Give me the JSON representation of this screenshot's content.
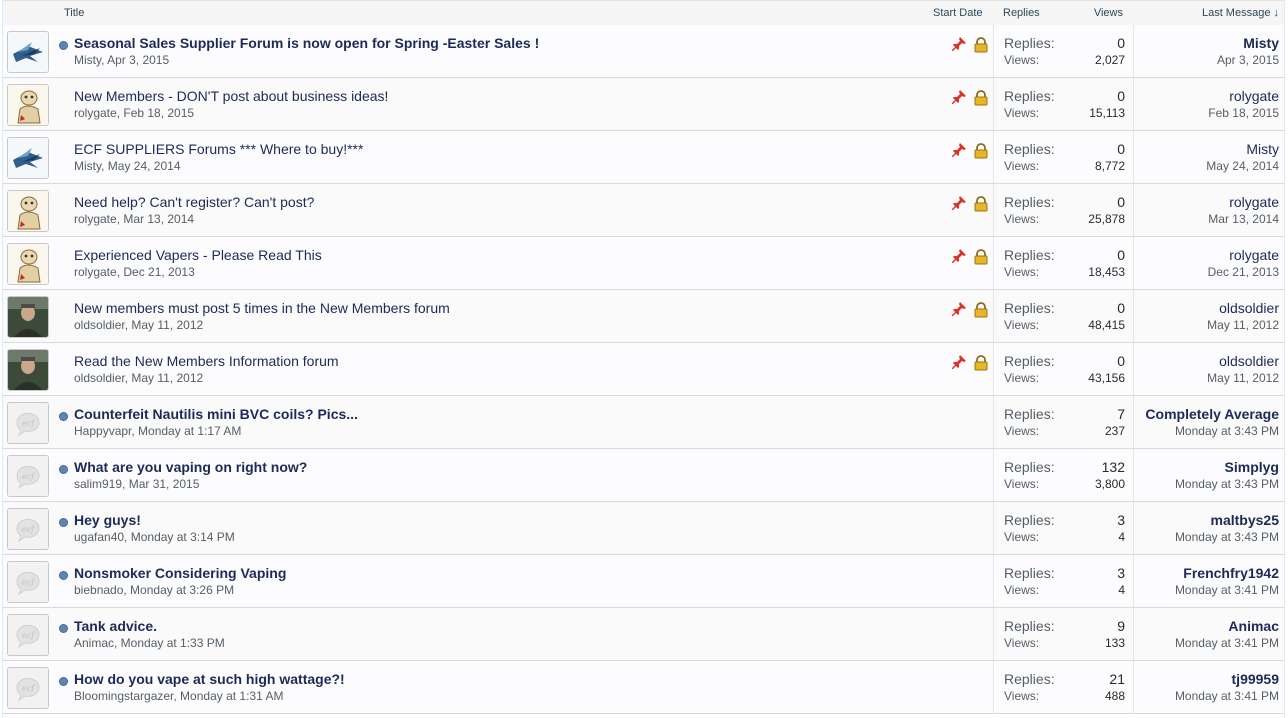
{
  "columns": {
    "title": "Title",
    "start_date": "Start Date",
    "replies": "Replies",
    "views": "Views",
    "last_message": "Last Message ↓"
  },
  "labels": {
    "replies": "Replies:",
    "views": "Views:"
  },
  "threads": [
    {
      "title": "Seasonal Sales Supplier Forum is now open for Spring -Easter Sales !",
      "meta": "Misty, Apr 3, 2015",
      "replies": "0",
      "views": "2,027",
      "last_user": "Misty",
      "last_date": "Apr 3, 2015",
      "avatar": "bird-avatar",
      "sticky": true,
      "unread": true
    },
    {
      "title": "New Members - DON'T post about business ideas!",
      "meta": "rolygate, Feb 18, 2015",
      "replies": "0",
      "views": "15,113",
      "last_user": "rolygate",
      "last_date": "Feb 18, 2015",
      "avatar": "cartoon-avatar",
      "sticky": true,
      "unread": false
    },
    {
      "title": "ECF SUPPLIERS Forums *** Where to buy!***",
      "meta": "Misty, May 24, 2014",
      "replies": "0",
      "views": "8,772",
      "last_user": "Misty",
      "last_date": "May 24, 2014",
      "avatar": "bird-avatar",
      "sticky": true,
      "unread": false
    },
    {
      "title": "Need help? Can't register? Can't post?",
      "meta": "rolygate, Mar 13, 2014",
      "replies": "0",
      "views": "25,878",
      "last_user": "rolygate",
      "last_date": "Mar 13, 2014",
      "avatar": "cartoon-avatar",
      "sticky": true,
      "unread": false
    },
    {
      "title": "Experienced Vapers - Please Read This",
      "meta": "rolygate, Dec 21, 2013",
      "replies": "0",
      "views": "18,453",
      "last_user": "rolygate",
      "last_date": "Dec 21, 2013",
      "avatar": "cartoon-avatar",
      "sticky": true,
      "unread": false
    },
    {
      "title": "New members must post 5 times in the New Members forum",
      "meta": "oldsoldier, May 11, 2012",
      "replies": "0",
      "views": "48,415",
      "last_user": "oldsoldier",
      "last_date": "May 11, 2012",
      "avatar": "photo-avatar",
      "sticky": true,
      "unread": false
    },
    {
      "title": "Read the New Members Information forum",
      "meta": "oldsoldier, May 11, 2012",
      "replies": "0",
      "views": "43,156",
      "last_user": "oldsoldier",
      "last_date": "May 11, 2012",
      "avatar": "photo-avatar",
      "sticky": true,
      "unread": false
    },
    {
      "title": "Counterfeit Nautilis mini BVC coils? Pics...",
      "meta": "Happyvapr, Monday at 1:17 AM",
      "replies": "7",
      "views": "237",
      "last_user": "Completely Average",
      "last_date": "Monday at 3:43 PM",
      "avatar": "default-avatar",
      "sticky": false,
      "unread": true
    },
    {
      "title": "What are you vaping on right now?",
      "meta": "salim919, Mar 31, 2015",
      "replies": "132",
      "views": "3,800",
      "last_user": "Simplyg",
      "last_date": "Monday at 3:43 PM",
      "avatar": "default-avatar",
      "sticky": false,
      "unread": true
    },
    {
      "title": "Hey guys!",
      "meta": "ugafan40, Monday at 3:14 PM",
      "replies": "3",
      "views": "4",
      "last_user": "maltbys25",
      "last_date": "Monday at 3:43 PM",
      "avatar": "default-avatar",
      "sticky": false,
      "unread": true
    },
    {
      "title": "Nonsmoker Considering Vaping",
      "meta": "biebnado, Monday at 3:26 PM",
      "replies": "3",
      "views": "4",
      "last_user": "Frenchfry1942",
      "last_date": "Monday at 3:41 PM",
      "avatar": "default-avatar",
      "sticky": false,
      "unread": true
    },
    {
      "title": "Tank advice.",
      "meta": "Animac, Monday at 1:33 PM",
      "replies": "9",
      "views": "133",
      "last_user": "Animac",
      "last_date": "Monday at 3:41 PM",
      "avatar": "default-avatar",
      "sticky": false,
      "unread": true
    },
    {
      "title": "How do you vape at such high wattage?!",
      "meta": "Bloomingstargazer, Monday at 1:31 AM",
      "replies": "21",
      "views": "488",
      "last_user": "tj99959",
      "last_date": "Monday at 3:41 PM",
      "avatar": "default-avatar",
      "sticky": false,
      "unread": true
    }
  ]
}
